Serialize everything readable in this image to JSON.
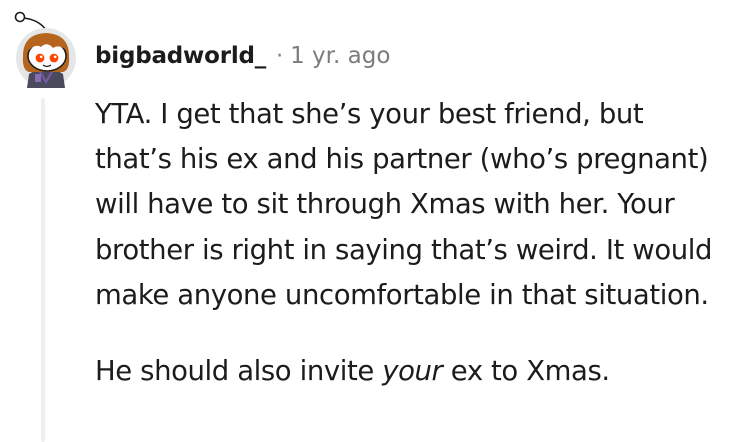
{
  "comment": {
    "author": "bigbadworld_",
    "separator": "·",
    "timestamp": "1 yr. ago",
    "avatar_icon": "snoo-avatar-icon",
    "body": {
      "paragraph_1": "YTA. I get that she’s your best friend, but that’s his ex and his partner (who’s pregnant) will have to sit through Xmas with her. Your brother is right in saying that’s weird. It would make anyone uncomfortable in that situation.",
      "paragraph_2": {
        "before": "He should also invite ",
        "emphasis": "your",
        "after": " ex to Xmas."
      }
    }
  },
  "colors": {
    "text": "#1c1c1c",
    "meta": "#7c7c7c",
    "thread_line": "#edeff1",
    "avatar_hair": "#b5651d",
    "avatar_eyes": "#ff4500"
  }
}
